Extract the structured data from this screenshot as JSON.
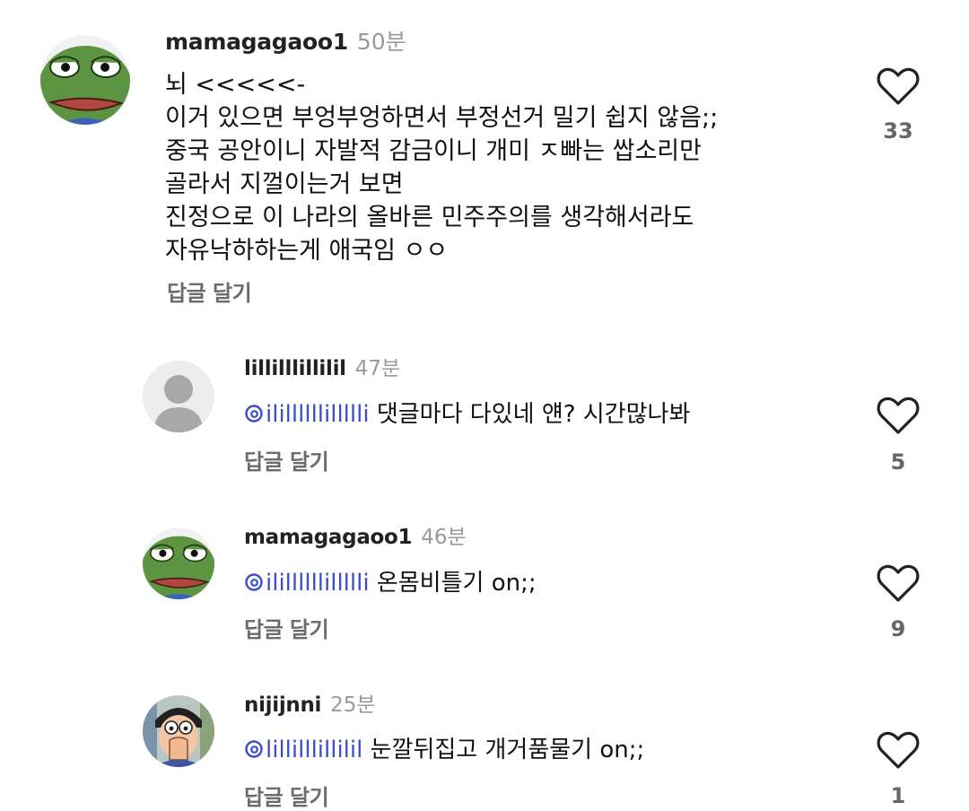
{
  "reply_label": "답글 달기",
  "comments": [
    {
      "username": "mamagagaoo1",
      "time": "50분",
      "lines": [
        "뇌 <<<<<-",
        "이거 있으면 부엉부엉하면서 부정선거 밀기 쉽지 않음;;",
        "중국 공안이니 자발적 감금이니 개미 ㅈ빠는 쌉소리만",
        "골라서 지껄이는거 보면",
        "진정으로 이 나라의 올바른 민주주의를 생각해서라도",
        "자유낙하하는게 애국임 ㅇㅇ"
      ],
      "likes": "33",
      "avatar": "frog-avatar"
    },
    {
      "username": "lillilllillilil",
      "time": "47분",
      "mention": "ilillllllillllli",
      "text": "댓글마다 다있네 얜? 시간많나봐",
      "likes": "5",
      "avatar": "default-avatar"
    },
    {
      "username": "mamagagaoo1",
      "time": "46분",
      "mention": "ilillllllillllli",
      "text": "온몸비틀기 on;;",
      "likes": "9",
      "avatar": "frog-avatar"
    },
    {
      "username": "nijijnni",
      "time": "25분",
      "mention": "lillilllillilil",
      "text": "눈깔뒤집고 개거품물기 on;;",
      "likes": "1",
      "avatar": "cartoon-avatar"
    }
  ],
  "colors": {
    "mention": "#3a4fc9",
    "secondary": "#6b6b6b",
    "time": "#9a9a9a"
  }
}
